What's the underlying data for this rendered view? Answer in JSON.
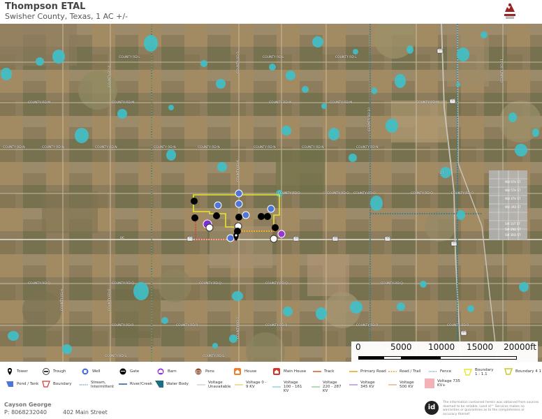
{
  "header": {
    "title": "Thompson ETAL",
    "subtitle": "Swisher County, Texas, 1 AC +/-",
    "logo_icon": "george-land-logo"
  },
  "map": {
    "road_labels": [
      "COUNTY RD L",
      "COUNTY RD L",
      "COUNTY RD L",
      "COUNTY RD M",
      "COUNTY RD M",
      "COUNTY RD M",
      "COUNTY RD M",
      "COUNTY RD M",
      "COUNTY RD N",
      "COUNTY RD N",
      "COUNTY RD N",
      "COUNTY RD N",
      "COUNTY RD N",
      "COUNTY RD N",
      "COUNTY RD N",
      "COUNTY RD N",
      "COUNTY RD O",
      "COUNTY RD O",
      "COUNTY RD O",
      "COUNTY RD O",
      "COUNTY RD O",
      "COUNTY RD Q",
      "COUNTY RD Q",
      "COUNTY RD Q",
      "COUNTY RD Q",
      "COUNTY RD Q",
      "COUNTY RD R",
      "COUNTY RD R",
      "COUNTY RD R",
      "COUNTY RD R",
      "COUNTY RD R",
      "COUNTY RD S",
      "COUNTY RD S",
      "COUNTY RD 4",
      "COUNTY RD 5",
      "COUNTY RD 6",
      "COUNTY RD 7",
      "COUNTY RD 8",
      "COUNTY RD 9",
      "COUNTY RD 10",
      "COUNTY RD 11"
    ],
    "highway_labels": [
      "86",
      "86",
      "86",
      "86",
      "86",
      "87",
      "87",
      "27",
      "27",
      "27"
    ],
    "town_labels": [
      "NW 6TH ST",
      "NW 5TH ST",
      "NW 4TH ST",
      "NW 3RD ST",
      "SW 1ST ST",
      "SW 2ND ST",
      "SW 3RD ST"
    ],
    "colors": {
      "water": "#3fc1c9",
      "boundary_yellow": "#e6e62a",
      "boundary_red": "#e03030",
      "fence": "#2f7a8f"
    }
  },
  "scale_bar": {
    "labels": [
      "0",
      "5000",
      "10000",
      "15000",
      "20000ft"
    ]
  },
  "legend": {
    "items": [
      {
        "label": "Tower",
        "icon": "tower-icon"
      },
      {
        "label": "Trough",
        "icon": "trough-icon"
      },
      {
        "label": "Well",
        "icon": "well-icon"
      },
      {
        "label": "Gate",
        "icon": "gate-icon"
      },
      {
        "label": "Barn",
        "icon": "barn-icon"
      },
      {
        "label": "Pens",
        "icon": "pens-icon"
      },
      {
        "label": "House",
        "icon": "house-icon"
      },
      {
        "label": "Main House",
        "icon": "main-house-icon"
      },
      {
        "label": "Track",
        "icon": "track-line"
      },
      {
        "label": "Primary Road",
        "icon": "primary-road-line"
      },
      {
        "label": "Road / Trail",
        "icon": "road-trail-line"
      },
      {
        "label": "Fence",
        "icon": "fence-line"
      },
      {
        "label": "Boundary 1 : 1.1",
        "icon": "boundary-1-icon"
      },
      {
        "label": "Boundary 4 1",
        "icon": "boundary-4-icon"
      },
      {
        "label": "Pond / Tank",
        "icon": "pond-icon"
      },
      {
        "label": "Boundary",
        "icon": "boundary-icon"
      },
      {
        "label": "Stream, Intermittent",
        "icon": "stream-line"
      },
      {
        "label": "River/Creek",
        "icon": "river-line"
      },
      {
        "label": "Water Body",
        "icon": "water-body-icon"
      },
      {
        "label": "Voltage Unavailable",
        "icon": "voltage-line"
      },
      {
        "label": "Voltage 0 - 9 KV",
        "icon": "voltage-line"
      },
      {
        "label": "Voltage 100 - 161 KV",
        "icon": "voltage-line"
      },
      {
        "label": "Voltage 220 - 287 KV",
        "icon": "voltage-line"
      },
      {
        "label": "Voltage 345 KV",
        "icon": "voltage-line"
      },
      {
        "label": "Voltage 500 KV",
        "icon": "voltage-line"
      },
      {
        "label": "Voltage 735 KV+",
        "icon": "voltage-swatch"
      }
    ]
  },
  "footer": {
    "agent_name": "Cayson George",
    "phone": "P: 8068232040",
    "address": "402 Main Street",
    "brand_icon": "id",
    "disclaimer": "The information contained herein was obtained from sources deemed to be reliable. Land id™ Services makes no warranties or guarantees as to the completeness or accuracy thereof."
  }
}
